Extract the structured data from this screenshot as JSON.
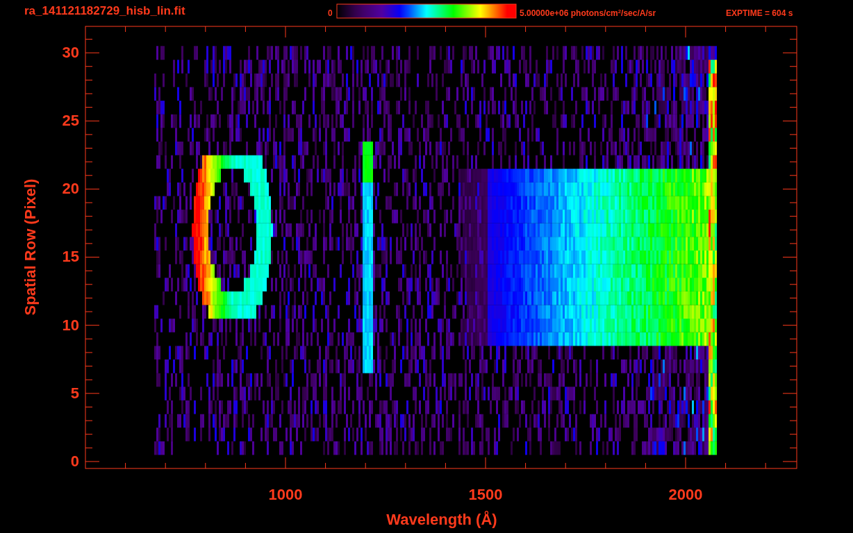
{
  "title": "ra_141121182729_hisb_lin.fit",
  "colorbar": {
    "min_label": "0",
    "max_label": "5.00000e+06 photons/cm$^{2}$/sec/A/sr"
  },
  "exposure": "EXPTIME = 604 s",
  "x_axis": {
    "label": "Wavelength (Å)",
    "ticks": [
      "1000",
      "1500",
      "2000"
    ]
  },
  "y_axis": {
    "label": "Spatial Row (Pixel)",
    "ticks": [
      "30",
      "25",
      "20",
      "15",
      "10",
      "5",
      "0"
    ]
  }
}
